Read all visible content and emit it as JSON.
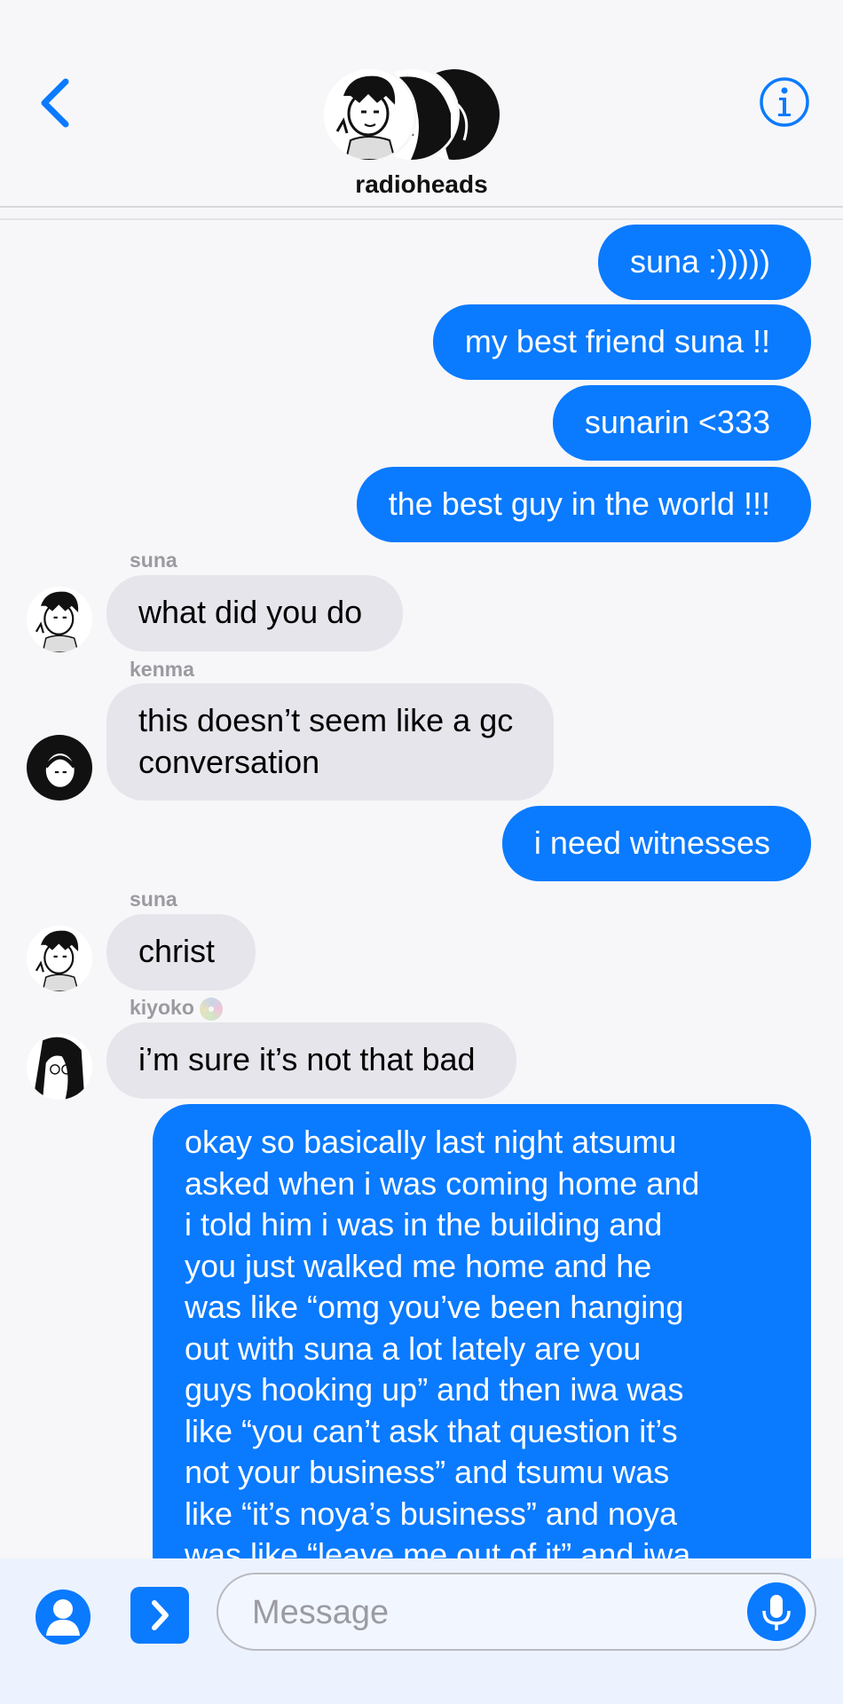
{
  "header": {
    "group_name": "radioheads",
    "back_icon": "chevron-left-icon",
    "info_icon": "info-icon",
    "accent": "#0a7aff"
  },
  "messages": [
    {
      "dir": "out",
      "text": "suna :)))))"
    },
    {
      "dir": "out",
      "text": "my best friend suna !!"
    },
    {
      "dir": "out",
      "text": "sunarin <333"
    },
    {
      "dir": "out",
      "text": "the best guy in the world !!!"
    },
    {
      "dir": "in",
      "sender": "suna",
      "text": "what did you do"
    },
    {
      "dir": "in",
      "sender": "kenma",
      "lines": [
        "this doesn’t seem like a gc",
        "conversation"
      ]
    },
    {
      "dir": "out",
      "text": "i need witnesses"
    },
    {
      "dir": "in",
      "sender": "suna",
      "text": "christ"
    },
    {
      "dir": "in",
      "sender": "kiyoko",
      "text": "i’m sure it’s not that bad"
    },
    {
      "dir": "out",
      "lines": [
        "okay so basically last night atsumu",
        "asked when i was coming home and",
        "i told him i was in the building and",
        "you just walked me home and he",
        "was like “omg you’ve been hanging",
        "out with suna a lot lately are you",
        "guys hooking up” and then iwa was",
        "like “you can’t ask that question it’s",
        "not your business” and tsumu was",
        "like “it’s noya’s business” and noya",
        "was like “leave me out of it” and iwa"
      ]
    }
  ],
  "composer": {
    "placeholder": "Message",
    "contact_icon": "person-icon",
    "apps_icon": "chevron-right-icon",
    "mic_icon": "microphone-icon"
  }
}
